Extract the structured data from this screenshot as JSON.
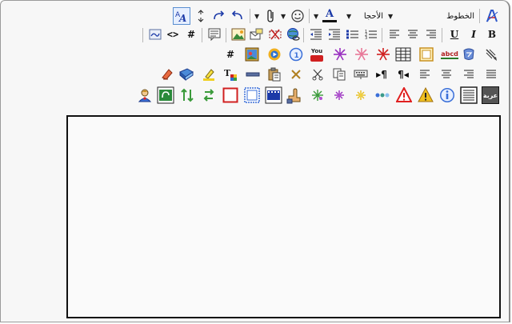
{
  "toolbar": {
    "font_label": "الخطوط",
    "size_label": "الأحجا",
    "underline_label": "U",
    "italic_label": "I",
    "bold_label": "B",
    "youtube_label": "You",
    "abcd_label": "abcd",
    "word_label": "عربة",
    "hash_label": "#",
    "code_label": "<>",
    "pilcrow_label": "¶",
    "text_color_label": "A"
  },
  "colors": {
    "accent_blue": "#2b55c9",
    "warning_red": "#e02020",
    "warning_yellow": "#f0c020",
    "info_blue": "#3a6fd8"
  },
  "icons": {
    "row1": [
      "remove-format-icon",
      "font-dropdown",
      "size-dropdown",
      "text-color-icon",
      "smiley-icon",
      "attachment-icon",
      "undo-icon",
      "redo-icon",
      "resize-icon",
      "styled-a-icon"
    ],
    "row2": [
      "bold-icon",
      "italic-icon",
      "underline-icon",
      "align-right-icon",
      "align-center-icon",
      "align-left-icon",
      "numbered-list-icon",
      "bulleted-list-icon",
      "indent-icon",
      "outdent-icon",
      "globe-link-icon",
      "unlink-icon",
      "email-icon",
      "image-icon",
      "quote-icon",
      "hash-icon",
      "code-icon",
      "php-icon"
    ],
    "row3": [
      "brush-icon",
      "flash-icon",
      "table-icon",
      "sparkle-red-icon",
      "sparkle-pink-icon",
      "sparkle-purple-icon",
      "youtube-icon",
      "info-circle-icon",
      "media-player-icon",
      "gallery-icon",
      "hash-icon"
    ],
    "row4": [
      "justify-icon",
      "align-right-icon",
      "align-center-icon",
      "align-left-icon",
      "rtl-icon",
      "ltr-icon",
      "keyboard-icon",
      "copy-icon",
      "cut-icon",
      "delete-icon",
      "paste-icon",
      "horizontal-rule-icon",
      "text-size-icon",
      "highlighter-icon",
      "book-icon",
      "eraser-icon"
    ],
    "row5": [
      "word-icon",
      "list-box-icon",
      "info-icon",
      "warning-yellow-icon",
      "warning-red-icon",
      "dots-icon",
      "star-yellow-icon",
      "star-purple-icon",
      "star-green-icon",
      "hand-icon",
      "film-icon",
      "frame-blue-icon",
      "frame-red-icon",
      "arrows-swap-icon",
      "arrows-updown-icon",
      "green-box-icon",
      "person-icon"
    ]
  }
}
